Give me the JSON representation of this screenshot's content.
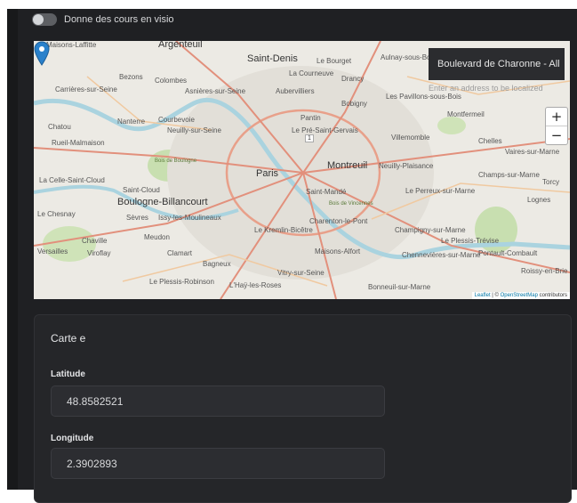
{
  "toggle": {
    "label": "Donne des cours en visio",
    "checked": false
  },
  "map": {
    "search_value": "Boulevard de Charonne - All",
    "search_placeholder": "Enter an address to be localized",
    "zoom_in": "+",
    "zoom_out": "−",
    "attribution_leaflet": "Leaflet",
    "attribution_sep": " | © ",
    "attribution_osm": "OpenStreetMap",
    "attribution_tail": " contributors",
    "cluster_count": "1",
    "marker_color": "#2a81cb",
    "labels": {
      "maisons_laffitte": "Maisons-Laffitte",
      "argenteuil": "Argenteuil",
      "saint_denis": "Saint-Denis",
      "le_bourget": "Le Bourget",
      "aulnay": "Aulnay-sous-Bois",
      "drancy": "Drancy",
      "bezons": "Bezons",
      "colombes": "Colombes",
      "la_courneuve": "La Courneuve",
      "carrieres": "Carrières-sur-Seine",
      "asnieres": "Asnières-sur-Seine",
      "aubervilliers": "Aubervilliers",
      "bobigny": "Bobigny",
      "les_pavillons": "Les Pavillons-sous-Bois",
      "montfermeil": "Montfermeil",
      "chatou": "Chatou",
      "nanterre": "Nanterre",
      "courbevoie": "Courbevoie",
      "neuilly": "Neuilly-sur-Seine",
      "pantin": "Pantin",
      "le_pre": "Le Pré-Saint-Gervais",
      "rueil": "Rueil-Malmaison",
      "villemomble": "Villemomble",
      "chelles": "Chelles",
      "vaires": "Vaires-sur-Marne",
      "paris": "Paris",
      "montreuil": "Montreuil",
      "neuilly_plaisance": "Neuilly-Plaisance",
      "la_celle": "La Celle-Saint-Cloud",
      "saint_cloud": "Saint-Cloud",
      "saint_mande": "Saint-Mandé",
      "le_perreux": "Le Perreux-sur-Marne",
      "champs": "Champs-sur-Marne",
      "torcy": "Torcy",
      "boulogne": "Boulogne-Billancourt",
      "lognes": "Lognes",
      "le_chesnay": "Le Chesnay",
      "sevres": "Sèvres",
      "issy": "Issy-les-Moulineaux",
      "charenton": "Charenton-le-Pont",
      "le_kremlin": "Le Kremlin-Bicêtre",
      "champigny": "Champigny-sur-Marne",
      "meudon": "Meudon",
      "chaville": "Chaville",
      "versailles": "Versailles",
      "viroflay": "Viroflay",
      "clamart": "Clamart",
      "bagneux": "Bagneux",
      "maisons_alfort": "Maisons-Alfort",
      "chennevieres": "Chennevières-sur-Marne",
      "le_plessis_trevise": "Le Plessis-Trévise",
      "pontault": "Pontault-Combault",
      "roissy": "Roissy-en-Brie",
      "vitry": "Vitry-sur-Seine",
      "le_plessis_robinson": "Le Plessis-Robinson",
      "lhay": "L'Haÿ-les-Roses",
      "bonneuil": "Bonneuil-sur-Marne",
      "bois_boulogne": "Bois de Boulogne",
      "bois_vincennes": "Bois de Vincennes"
    }
  },
  "card": {
    "title": "Carte e",
    "latitude_label": "Latitude",
    "latitude_value": "48.8582521",
    "longitude_label": "Longitude",
    "longitude_value": "2.3902893"
  }
}
